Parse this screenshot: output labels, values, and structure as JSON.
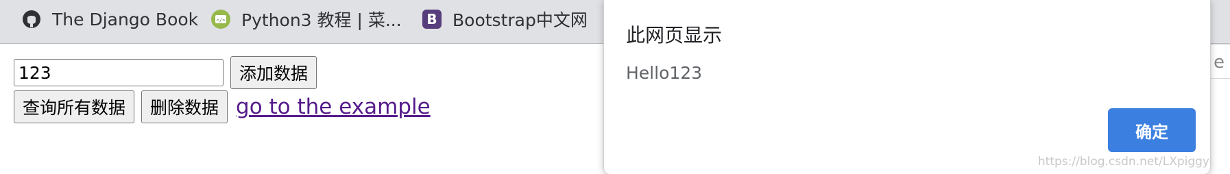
{
  "bookmarks": [
    {
      "label": "The Django Book",
      "icon": "github-icon"
    },
    {
      "label": "Python3 教程 | 菜...",
      "icon": "runoob-icon"
    },
    {
      "label": "Bootstrap中文网",
      "icon": "bootstrap-icon"
    }
  ],
  "form": {
    "input_value": "123",
    "add_button": "添加数据",
    "query_button": "查询所有数据",
    "delete_button": "删除数据",
    "link_text": "go to the example"
  },
  "dialog": {
    "title": "此网页显示",
    "message": "Hello123",
    "ok_button": "确定"
  },
  "watermark": "https://blog.csdn.net/LXpiggy",
  "right_edge_char": "e",
  "colors": {
    "bookmark_bar": "#dfe1e5",
    "link": "#551a8b",
    "primary_button": "#3b7fe0"
  }
}
